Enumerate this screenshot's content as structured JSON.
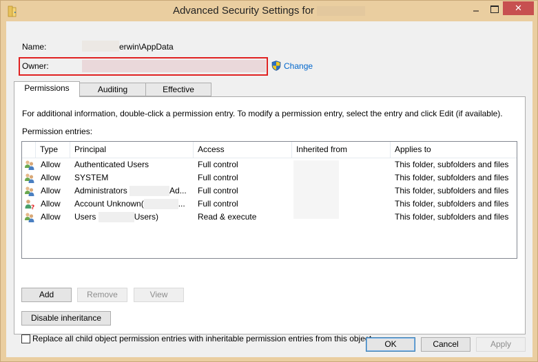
{
  "window": {
    "title": "Advanced Security Settings for",
    "minimize_label": "",
    "maximize_label": "",
    "close_label": "✕"
  },
  "header": {
    "name_label": "Name:",
    "name_value": "erwin\\AppData",
    "owner_label": "Owner:",
    "change_link": "Change"
  },
  "tabs": [
    {
      "label": "Permissions",
      "active": true
    },
    {
      "label": "Auditing",
      "active": false
    },
    {
      "label": "Effective Access",
      "active": false
    }
  ],
  "permissions": {
    "info_text": "For additional information, double-click a permission entry. To modify a permission entry, select the entry and click Edit (if available).",
    "entries_label": "Permission entries:",
    "columns": [
      "Type",
      "Principal",
      "Access",
      "Inherited from",
      "Applies to"
    ],
    "rows": [
      {
        "icon": "users-group-icon",
        "type": "Allow",
        "principal": "Authenticated Users",
        "access": "Full control",
        "inherited_from": "",
        "applies_to": "This folder, subfolders and files"
      },
      {
        "icon": "users-group-icon",
        "type": "Allow",
        "principal": "SYSTEM",
        "access": "Full control",
        "inherited_from": "",
        "applies_to": "This folder, subfolders and files"
      },
      {
        "icon": "users-group-icon",
        "type": "Allow",
        "principal": "Administrators",
        "principal_suffix": "Ad...",
        "access": "Full control",
        "inherited_from": "",
        "applies_to": "This folder, subfolders and files"
      },
      {
        "icon": "unknown-account-icon",
        "type": "Allow",
        "principal": "Account Unknown(",
        "principal_suffix": "...",
        "access": "Full control",
        "inherited_from": "",
        "applies_to": "This folder, subfolders and files"
      },
      {
        "icon": "users-group-icon",
        "type": "Allow",
        "principal": "Users",
        "principal_suffix": "Users)",
        "access": "Read & execute",
        "inherited_from": "",
        "applies_to": "This folder, subfolders and files"
      }
    ],
    "buttons": {
      "add": "Add",
      "remove": "Remove",
      "view": "View",
      "disable_inheritance": "Disable inheritance"
    },
    "replace_checkbox_label": "Replace all child object permission entries with inheritable permission entries from this object",
    "replace_checked": false
  },
  "footer": {
    "ok": "OK",
    "cancel": "Cancel",
    "apply": "Apply"
  },
  "colors": {
    "title_bar": "#eacea0",
    "close_button": "#c75050",
    "link": "#0066cc",
    "highlight_box": "#e02020"
  }
}
